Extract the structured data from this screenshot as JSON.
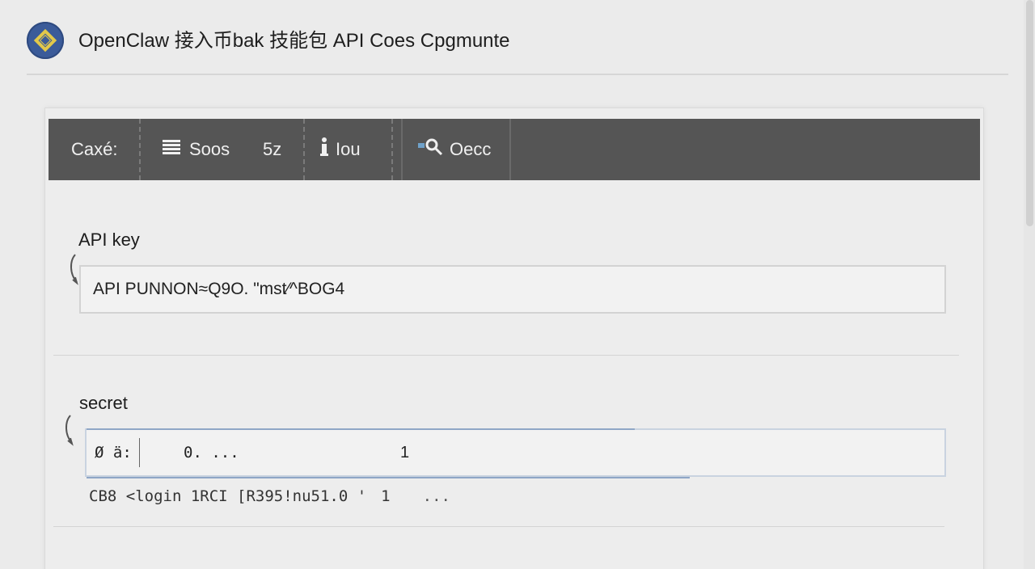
{
  "header": {
    "title": "OpenClaw 接入币bak 技能包 API Coes Cpgmunte",
    "logo_icon": "diamond-logo-icon"
  },
  "toolbar": {
    "items": [
      {
        "label": "Caxé:",
        "icon": ""
      },
      {
        "label": "Soos",
        "icon": "list-icon"
      },
      {
        "label": "5z",
        "icon": ""
      },
      {
        "label": "Iou",
        "icon": "info-icon"
      },
      {
        "label": "Oecc",
        "icon": "search-doc-icon"
      }
    ]
  },
  "form": {
    "api_key": {
      "label": "API key",
      "value": "API PUNNON≈Q9O. \"mst⁄^BOG4"
    },
    "secret": {
      "label": "secret",
      "prefix": "Ø ä:",
      "masked": "0. ...",
      "count": "1",
      "helper_text": "CB8 <login 1RCI [R395!nu51.0 '",
      "helper_count": "1",
      "helper_more": "..."
    }
  },
  "colors": {
    "toolbar_bg": "#555555",
    "logo_bg": "#3b5b99",
    "logo_accent": "#e2c84a",
    "focus_accent": "#8fa6c6"
  }
}
